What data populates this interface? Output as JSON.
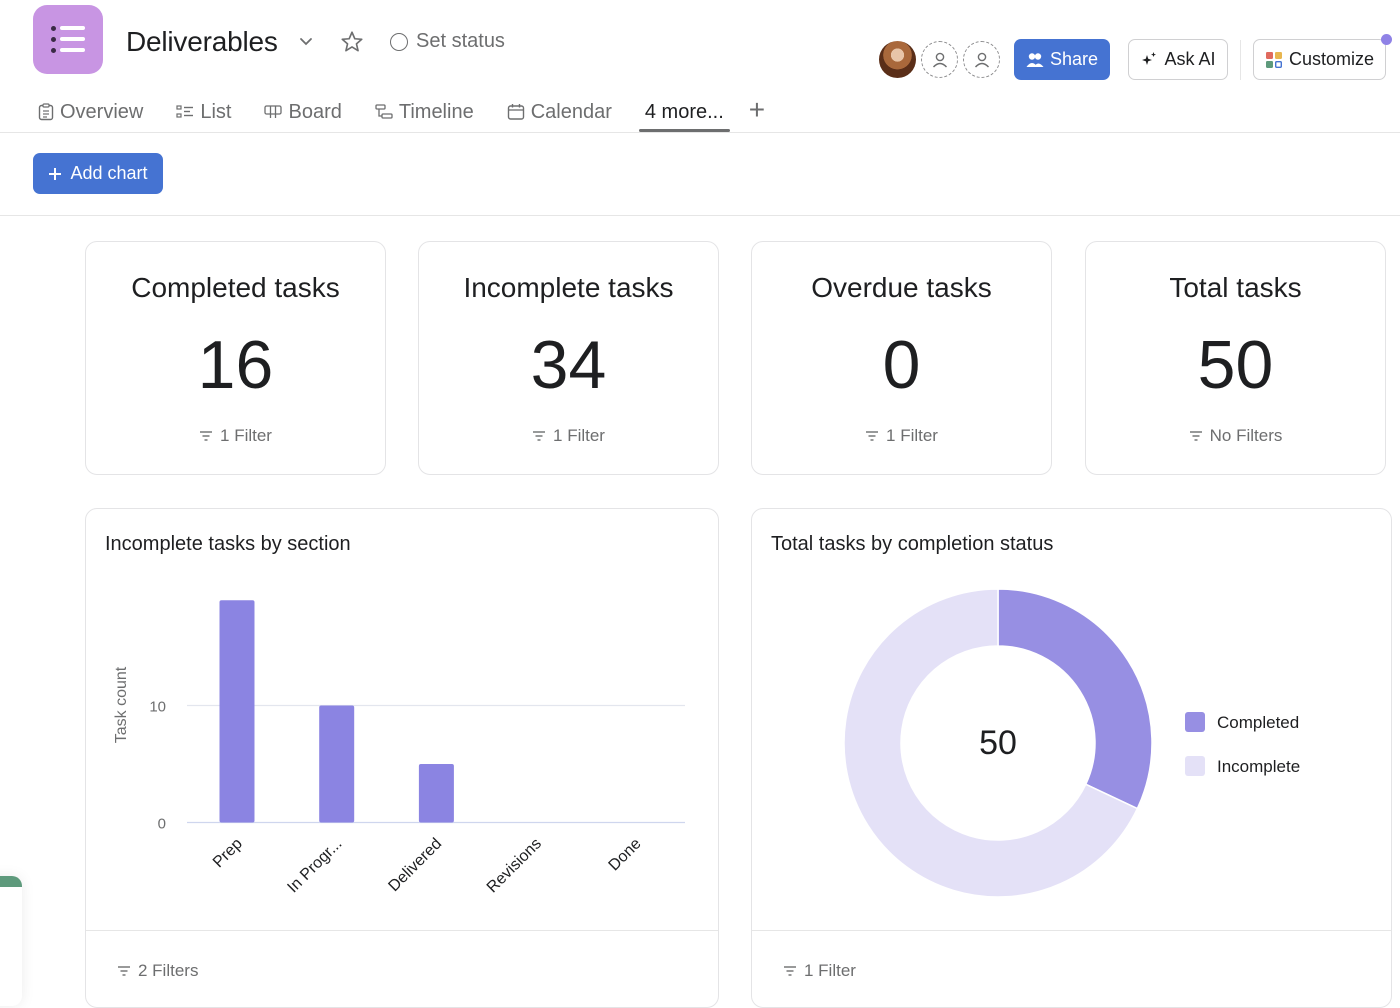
{
  "header": {
    "project_icon": "list-icon",
    "title": "Deliverables",
    "set_status": "Set status",
    "buttons": {
      "share": "Share",
      "ask_ai": "Ask AI",
      "customize": "Customize"
    },
    "accent_color": "#4573d2"
  },
  "tabs": [
    {
      "label": "Overview",
      "icon": "clipboard-icon"
    },
    {
      "label": "List",
      "icon": "list-icon"
    },
    {
      "label": "Board",
      "icon": "board-icon"
    },
    {
      "label": "Timeline",
      "icon": "timeline-icon"
    },
    {
      "label": "Calendar",
      "icon": "calendar-icon"
    },
    {
      "label": "4 more...",
      "active": true
    }
  ],
  "toolbar": {
    "add_chart": "Add chart"
  },
  "kpis": [
    {
      "title": "Completed tasks",
      "value": "16",
      "filter": "1 Filter"
    },
    {
      "title": "Incomplete tasks",
      "value": "34",
      "filter": "1 Filter"
    },
    {
      "title": "Overdue tasks",
      "value": "0",
      "filter": "1 Filter"
    },
    {
      "title": "Total tasks",
      "value": "50",
      "filter": "No Filters"
    }
  ],
  "charts": {
    "bar": {
      "title": "Incomplete tasks by section",
      "filter": "2 Filters"
    },
    "donut": {
      "title": "Total tasks by completion status",
      "filter": "1 Filter"
    }
  },
  "chart_data": [
    {
      "type": "bar",
      "title": "Incomplete tasks by section",
      "categories": [
        "Prep",
        "In Progr...",
        "Delivered",
        "Revisions",
        "Done"
      ],
      "values": [
        19,
        10,
        5,
        0,
        0
      ],
      "xlabel": "",
      "ylabel": "Task count",
      "yticks": [
        0,
        10
      ],
      "ylim": [
        0,
        20
      ],
      "grid": true,
      "color": "#8b84e2"
    },
    {
      "type": "pie",
      "subtype": "donut",
      "title": "Total tasks by completion status",
      "center_label": "50",
      "slices": [
        {
          "label": "Completed",
          "value": 16,
          "color": "#978fe3"
        },
        {
          "label": "Incomplete",
          "value": 34,
          "color": "#e4e1f7"
        }
      ],
      "legend": "right"
    }
  ]
}
